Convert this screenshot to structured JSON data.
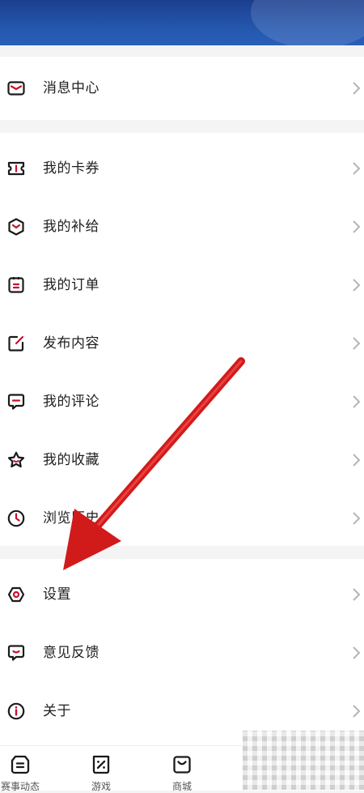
{
  "menu_groups": [
    {
      "items": [
        {
          "label": "消息中心",
          "icon": "mail-icon"
        }
      ]
    },
    {
      "items": [
        {
          "label": "我的卡券",
          "icon": "coupon-icon"
        },
        {
          "label": "我的补给",
          "icon": "supply-box-icon"
        },
        {
          "label": "我的订单",
          "icon": "order-icon"
        },
        {
          "label": "发布内容",
          "icon": "edit-icon"
        },
        {
          "label": "我的评论",
          "icon": "comment-icon"
        },
        {
          "label": "我的收藏",
          "icon": "star-icon"
        },
        {
          "label": "浏览历史",
          "icon": "clock-icon"
        }
      ]
    },
    {
      "items": [
        {
          "label": "设置",
          "icon": "gear-icon"
        },
        {
          "label": "意见反馈",
          "icon": "feedback-icon"
        },
        {
          "label": "关于",
          "icon": "info-icon"
        }
      ]
    }
  ],
  "tabbar": {
    "tabs": [
      {
        "label": "赛事动态",
        "icon": "news-icon"
      },
      {
        "label": "游戏",
        "icon": "game-icon"
      },
      {
        "label": "商城",
        "icon": "shop-icon"
      }
    ]
  },
  "colors": {
    "header": "#2456ad",
    "icon_accent": "#c8102e",
    "annotation_arrow": "#d11b1b"
  }
}
